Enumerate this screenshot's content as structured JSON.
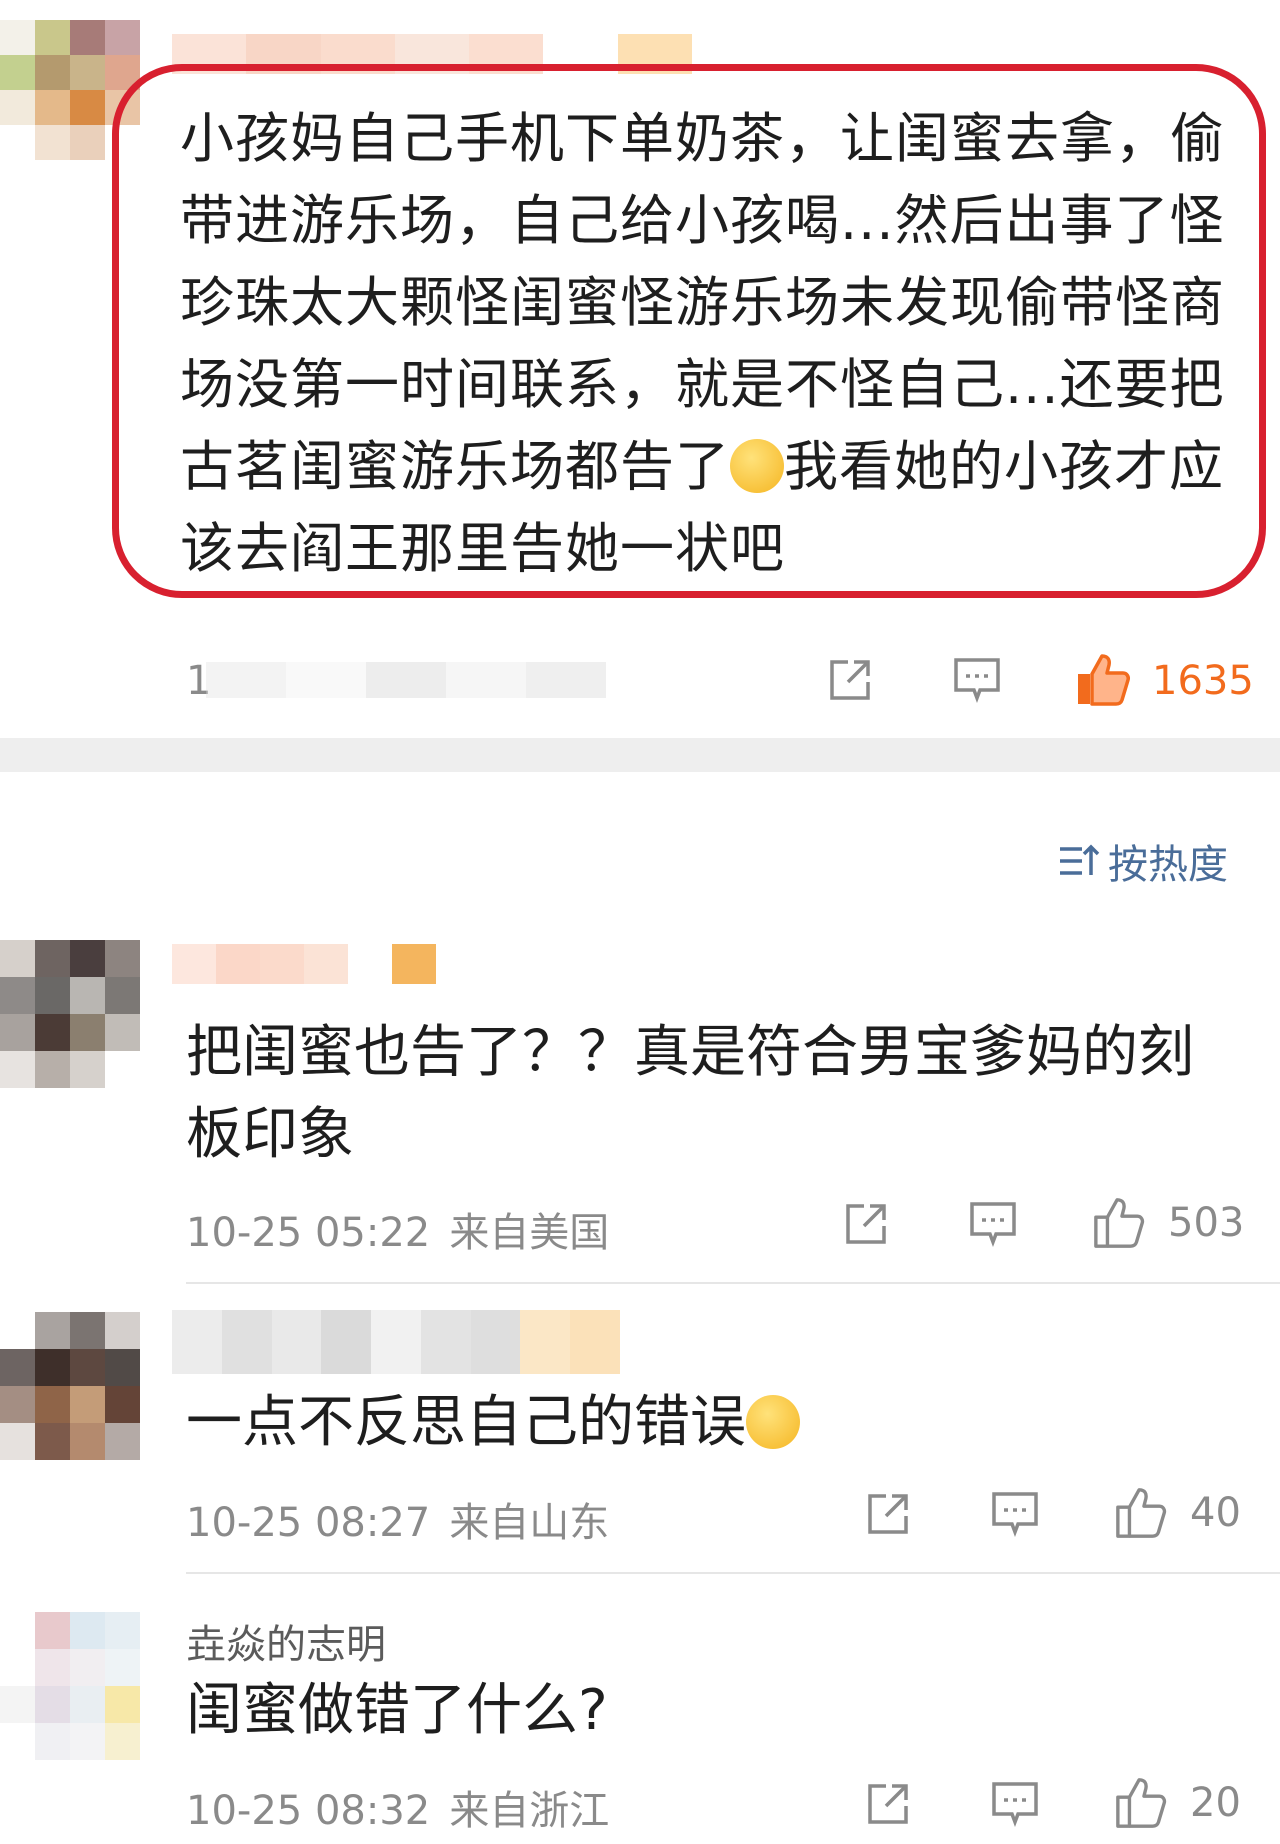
{
  "post": {
    "text": "小孩妈自己手机下单奶茶，让闺蜜去拿，偷带进游乐场，自己给小孩喝...然后出事了怪珍珠太大颗怪闺蜜怪游乐场未发现偷带怪商场没第一时间联系，就是不怪自己...还要把古茗闺蜜游乐场都告了",
    "text_tail": "我看她的小孩才应该去阎王那里告她一状吧",
    "emoji": "rolling-eyes-emoji",
    "meta": "1",
    "likes": "1635"
  },
  "sort_label": "按热度",
  "comments": [
    {
      "username": "",
      "text": "把闺蜜也告了？？真是符合男宝爹妈的刻板印象",
      "time": "10-25 05:22",
      "location": "来自美国",
      "likes": "503"
    },
    {
      "username": "",
      "text": "一点不反思自己的错误",
      "emoji": "thinking-eyeroll-emoji",
      "time": "10-25 08:27",
      "location": "来自山东",
      "likes": "40"
    },
    {
      "username": "垚焱的志明",
      "text": "闺蜜做错了什么?",
      "time": "10-25 08:32",
      "location": "来自浙江",
      "likes": "20"
    }
  ],
  "colors": {
    "highlight": "#d8202f",
    "like_active": "#f26b1d",
    "sort_text": "#4a6d99",
    "muted": "#8a8a8a"
  }
}
